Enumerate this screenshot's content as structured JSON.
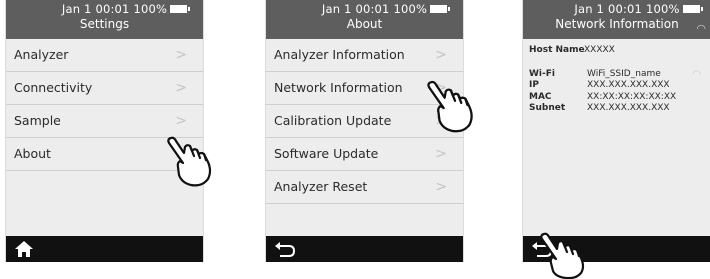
{
  "status": {
    "date": "Jan",
    "day": "1",
    "time": "00:01",
    "battery": "100%"
  },
  "screen1": {
    "title": "Settings",
    "items": [
      {
        "label": "Analyzer"
      },
      {
        "label": "Connectivity"
      },
      {
        "label": "Sample"
      },
      {
        "label": "About"
      }
    ],
    "nav_icon": "home-icon"
  },
  "screen2": {
    "title": "About",
    "items": [
      {
        "label": "Analyzer Information"
      },
      {
        "label": "Network Information"
      },
      {
        "label": "Calibration Update"
      },
      {
        "label": "Software Update"
      },
      {
        "label": "Analyzer Reset"
      }
    ],
    "nav_icon": "back-icon"
  },
  "screen3": {
    "title": "Network Information",
    "host_label": "Host Name",
    "host_value": "XXXXX",
    "wifi_label": "Wi-Fi",
    "wifi_value": "WiFi_SSID_name",
    "ip_label": "IP",
    "ip_value": "XXX.XXX.XXX.XXX",
    "mac_label": "MAC",
    "mac_value": "XX:XX:XX:XX:XX:XX",
    "subnet_label": "Subnet",
    "subnet_value": "XXX.XXX.XXX.XXX",
    "nav_icon": "back-icon"
  },
  "chevron": ">",
  "colors": {
    "header": "#5e5e5e",
    "body": "#ededed",
    "navbar": "#111111"
  }
}
